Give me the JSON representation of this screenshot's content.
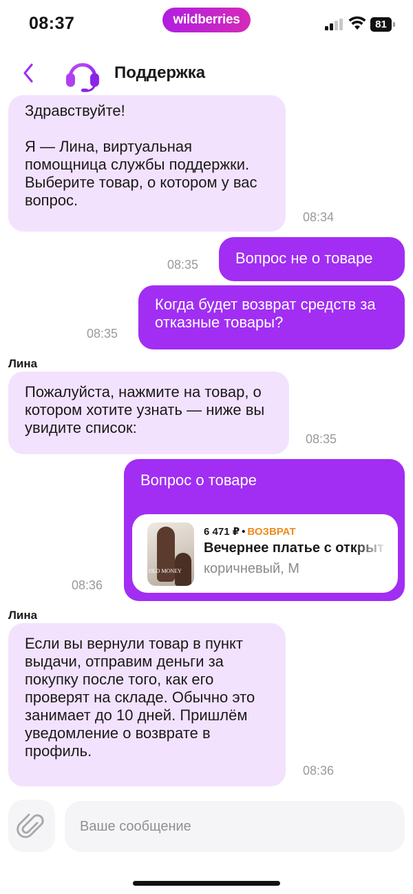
{
  "status_bar": {
    "time": "08:37",
    "brand": "wildberries",
    "battery": "81"
  },
  "header": {
    "title": "Поддержка",
    "back_icon": "chevron-left-icon",
    "avatar_icon": "headset-icon"
  },
  "messages": [
    {
      "type": "incoming",
      "text": "Здравствуйте!\n\nЯ — Лина, виртуальная помощница службы поддержки. Выберите товар, о котором у вас вопрос.",
      "time": "08:34"
    },
    {
      "type": "outgoing",
      "text": "Вопрос не о товаре",
      "time": "08:35"
    },
    {
      "type": "outgoing",
      "text": "Когда будет возврат средств за отказные товары?",
      "time": "08:35"
    },
    {
      "type": "incoming",
      "sender": "Лина",
      "text": "Пожалуйста, нажмите на товар, о котором хотите узнать — ниже вы увидите список:",
      "time": "08:35"
    },
    {
      "type": "outgoing",
      "text": "Вопрос о товаре",
      "time": "08:36",
      "product": {
        "price": "6 471 ₽",
        "separator": "•",
        "status": "ВОЗВРАТ",
        "name": "Вечернее платье с открыт",
        "meta": "коричневый, M",
        "thumb_text": "OLD MONEY"
      }
    },
    {
      "type": "incoming",
      "sender": "Лина",
      "text": "Если вы вернули товар в пункт выдачи, отправим деньги за покупку после того, как его проверят на складе. Обычно это занимает до 10 дней. Пришлём уведомление о возврате в профиль.",
      "time": "08:36"
    }
  ],
  "composer": {
    "placeholder": "Ваше сообщение",
    "attach_icon": "paperclip-icon"
  },
  "colors": {
    "accent": "#a12ef2",
    "incoming_bubble": "#f3e2fd",
    "return_status": "#f08a1c",
    "timestamp": "#9a9a9a"
  }
}
